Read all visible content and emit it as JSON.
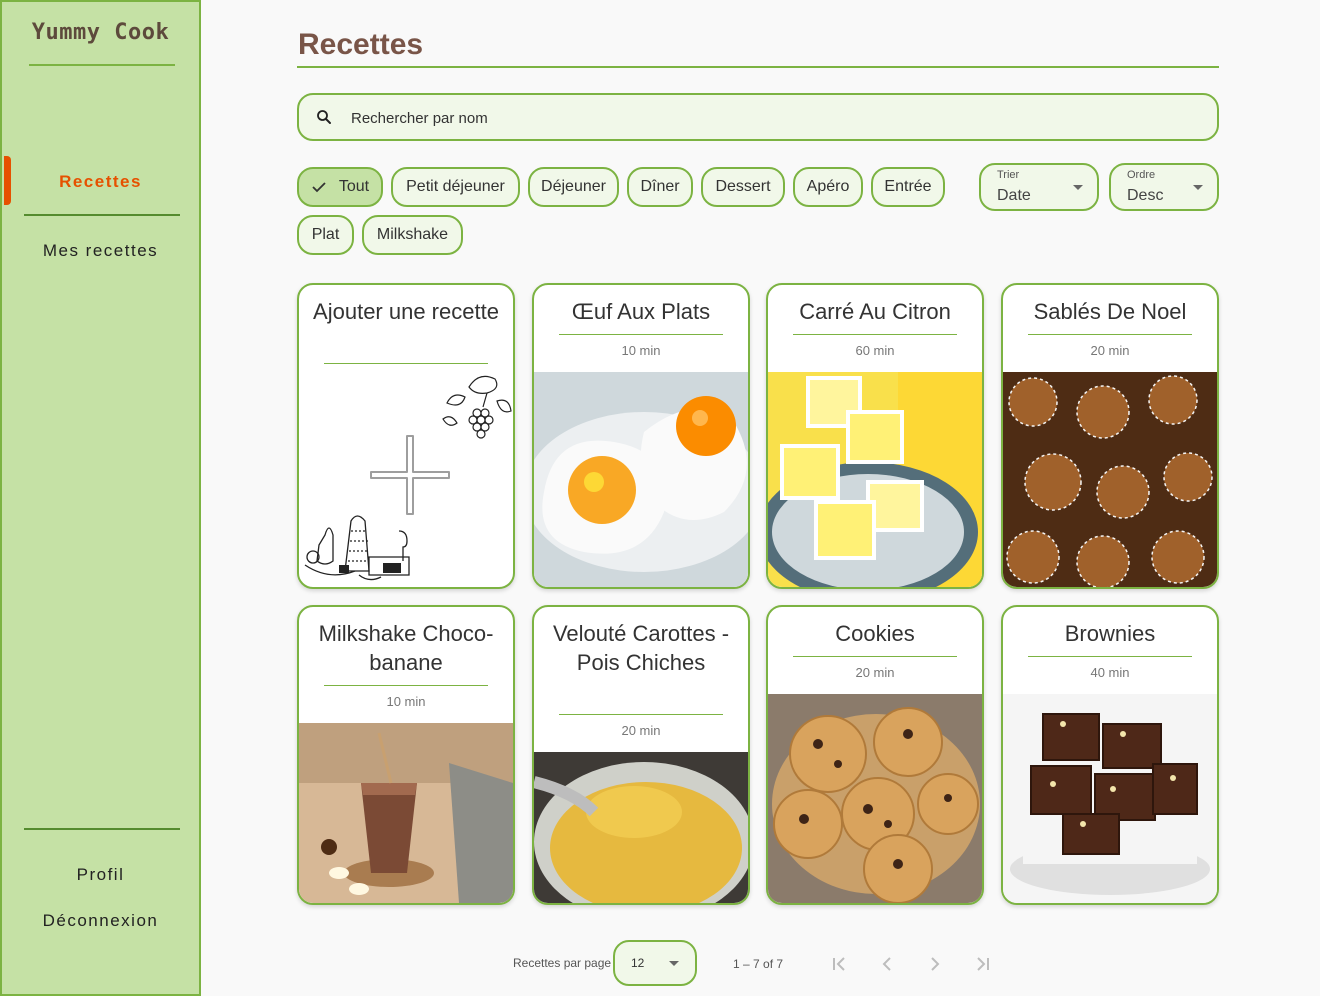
{
  "app": {
    "name": "Yummy Cook"
  },
  "sidebar": {
    "items": [
      {
        "label": "Recettes",
        "active": true
      },
      {
        "label": "Mes recettes",
        "active": false
      }
    ],
    "bottom": [
      {
        "label": "Profil"
      },
      {
        "label": "Déconnexion"
      }
    ]
  },
  "page": {
    "title": "Recettes"
  },
  "search": {
    "placeholder": "Rechercher par nom",
    "value": ""
  },
  "filters": {
    "chips": [
      {
        "label": "Tout",
        "selected": true
      },
      {
        "label": "Petit déjeuner",
        "selected": false
      },
      {
        "label": "Déjeuner",
        "selected": false
      },
      {
        "label": "Dîner",
        "selected": false
      },
      {
        "label": "Dessert",
        "selected": false
      },
      {
        "label": "Apéro",
        "selected": false
      },
      {
        "label": "Entrée",
        "selected": false
      },
      {
        "label": "Plat",
        "selected": false
      },
      {
        "label": "Milkshake",
        "selected": false
      }
    ],
    "sort": {
      "label": "Trier",
      "value": "Date"
    },
    "order": {
      "label": "Ordre",
      "value": "Desc"
    }
  },
  "add_card": {
    "label": "Ajouter une recette"
  },
  "recipes": [
    {
      "title": "Œuf Aux Plats",
      "time": "10 min"
    },
    {
      "title": "Carré Au Citron",
      "time": "60 min"
    },
    {
      "title": "Sablés De Noel",
      "time": "20 min"
    },
    {
      "title": "Milkshake Choco-banane",
      "time": "10 min"
    },
    {
      "title": "Velouté Carottes - Pois Chiches",
      "time": "20 min"
    },
    {
      "title": "Cookies",
      "time": "20 min"
    },
    {
      "title": "Brownies",
      "time": "40 min"
    }
  ],
  "pagination": {
    "per_page_label": "Recettes par page",
    "per_page": "12",
    "range": "1 – 7 of 7"
  },
  "colors": {
    "accent": "#7cb342",
    "sidebar": "#c5e1a5",
    "active": "#e65100",
    "title": "#795548"
  }
}
